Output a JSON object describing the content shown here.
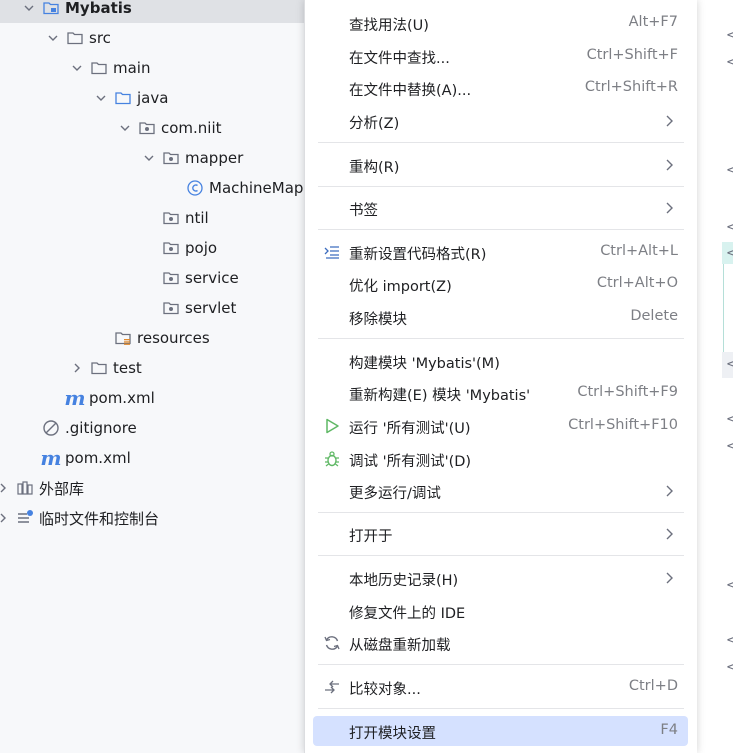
{
  "project_tree": {
    "root": "Mybatis",
    "src": "src",
    "main": "main",
    "java": "java",
    "package": "com.niit",
    "mapper": "mapper",
    "mapper_class": "MachineMap",
    "ntil": "ntil",
    "pojo": "pojo",
    "service": "service",
    "servlet": "servlet",
    "resources": "resources",
    "test": "test",
    "pom_inner": "pom.xml",
    "gitignore": ".gitignore",
    "pom_root": "pom.xml",
    "external_libs": "外部库",
    "scratches": "临时文件和控制台"
  },
  "context_menu": {
    "find_usages": {
      "label": "查找用法(U)",
      "shortcut": "Alt+F7"
    },
    "find_in_files": {
      "label": "在文件中查找...",
      "shortcut": "Ctrl+Shift+F"
    },
    "replace_in_files": {
      "label": "在文件中替换(A)...",
      "shortcut": "Ctrl+Shift+R"
    },
    "analyze": {
      "label": "分析(Z)"
    },
    "refactor": {
      "label": "重构(R)"
    },
    "bookmarks": {
      "label": "书签"
    },
    "reformat": {
      "label": "重新设置代码格式(R)",
      "shortcut": "Ctrl+Alt+L"
    },
    "optimize_imports": {
      "label": "优化 import(Z)",
      "shortcut": "Ctrl+Alt+O"
    },
    "remove_module": {
      "label": "移除模块",
      "shortcut": "Delete"
    },
    "build_module": {
      "label": "构建模块 'Mybatis'(M)"
    },
    "rebuild_module": {
      "label": "重新构建(E) 模块 'Mybatis'",
      "shortcut": "Ctrl+Shift+F9"
    },
    "run_tests": {
      "label": "运行 '所有测试'(U)",
      "shortcut": "Ctrl+Shift+F10"
    },
    "debug_tests": {
      "label": "调试 '所有测试'(D)"
    },
    "more_run": {
      "label": "更多运行/调试"
    },
    "open_in": {
      "label": "打开于"
    },
    "local_history": {
      "label": "本地历史记录(H)"
    },
    "repair_ide": {
      "label": "修复文件上的 IDE"
    },
    "reload_from_disk": {
      "label": "从磁盘重新加载"
    },
    "compare_with": {
      "label": "比较对象...",
      "shortcut": "Ctrl+D"
    },
    "module_settings": {
      "label": "打开模块设置",
      "shortcut": "F4"
    }
  },
  "editor_gutter": {
    "marker": "<"
  },
  "colors": {
    "highlight": "#d5e1ff",
    "folder": "#6c707e",
    "java_folder": "#4682e0",
    "run_green": "#5fb865"
  },
  "icons": [
    "module-folder-icon",
    "folder-icon",
    "package-icon",
    "class-icon",
    "maven-icon",
    "ignore-icon",
    "library-icon",
    "scratch-icon",
    "reformat-icon",
    "run-icon",
    "debug-icon",
    "reload-icon",
    "compare-icon",
    "chevron-right-icon",
    "chevron-down-icon"
  ]
}
